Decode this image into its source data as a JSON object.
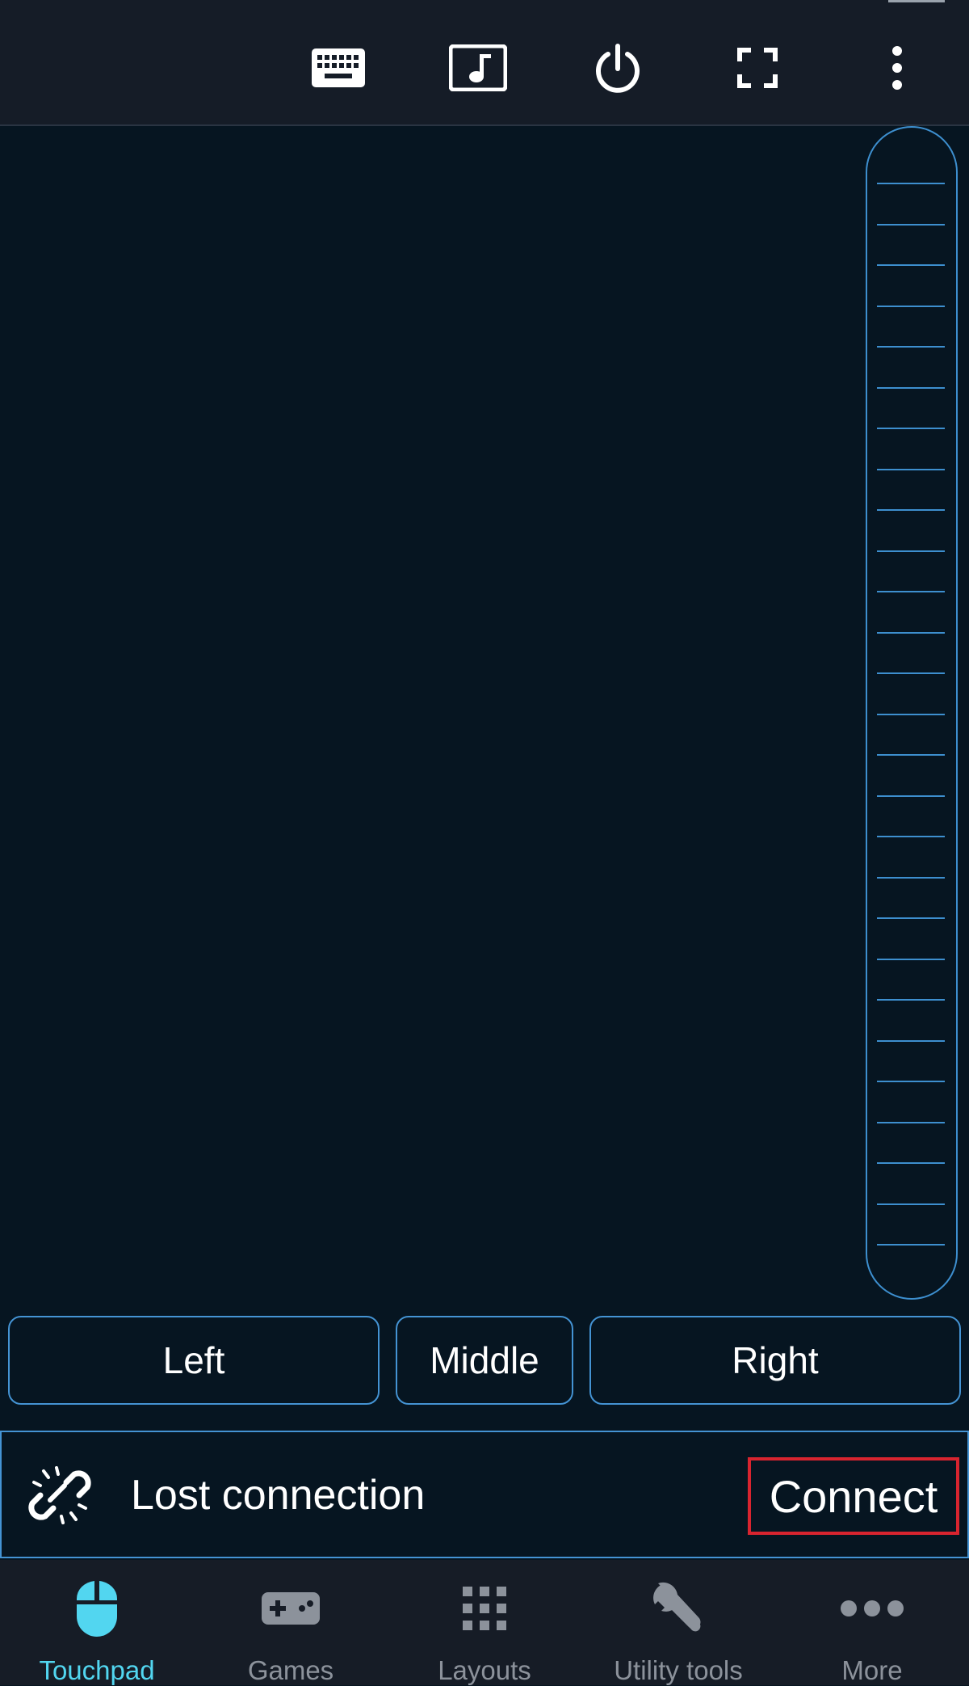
{
  "colors": {
    "background": "#061521",
    "topbar": "#151c27",
    "accent_outline": "#4493d3",
    "nav_active": "#52d6f0",
    "nav_inactive": "#8c929b",
    "highlight": "#d8242f"
  },
  "toolbar": {
    "icons": [
      "keyboard-icon",
      "music-note-icon",
      "power-icon",
      "fullscreen-icon",
      "more-vert-icon"
    ]
  },
  "mouse_buttons": {
    "left": "Left",
    "middle": "Middle",
    "right": "Right"
  },
  "connection": {
    "icon": "broken-link-icon",
    "status": "Lost connection",
    "action": "Connect"
  },
  "nav": {
    "items": [
      {
        "label": "Touchpad",
        "icon": "mouse-icon",
        "active": true
      },
      {
        "label": "Games",
        "icon": "gamepad-icon",
        "active": false
      },
      {
        "label": "Layouts",
        "icon": "grid-icon",
        "active": false
      },
      {
        "label": "Utility tools",
        "icon": "wrench-icon",
        "active": false
      },
      {
        "label": "More",
        "icon": "more-horiz-icon",
        "active": false
      }
    ]
  }
}
